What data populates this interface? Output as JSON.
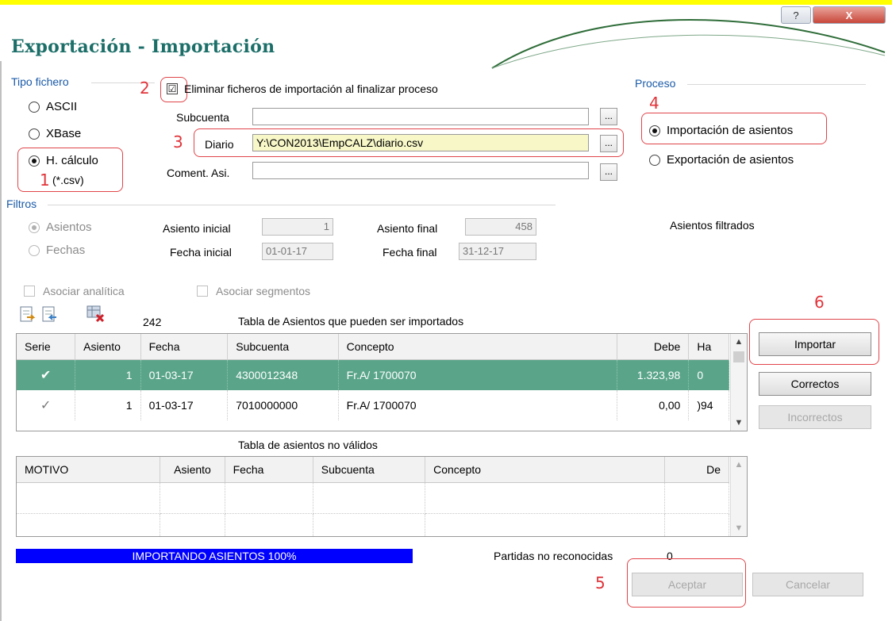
{
  "window": {
    "title": "Exportación - Importación",
    "help_label": "?",
    "close_label": "X"
  },
  "tipo_fichero": {
    "label": "Tipo fichero",
    "options": [
      {
        "label": "ASCII",
        "selected": false
      },
      {
        "label": "XBase",
        "selected": false
      },
      {
        "label": "H. cálculo",
        "sub": "(*.csv)",
        "selected": true
      }
    ]
  },
  "eliminar": {
    "label": "Eliminar ficheros de importación al finalizar proceso",
    "checked": true,
    "mark": "☑"
  },
  "files": {
    "subcuenta": {
      "label": "Subcuenta",
      "value": ""
    },
    "diario": {
      "label": "Diario",
      "value": "Y:\\CON2013\\EmpCALZ\\diario.csv"
    },
    "coment": {
      "label": "Coment. Asi.",
      "value": ""
    },
    "browse_label": "..."
  },
  "proceso": {
    "label": "Proceso",
    "options": [
      {
        "label": "Importación de asientos",
        "selected": true
      },
      {
        "label": "Exportación de asientos",
        "selected": false
      }
    ]
  },
  "filtros": {
    "label": "Filtros",
    "asientos": "Asientos",
    "fechas": "Fechas",
    "asiento_inicial_label": "Asiento inicial",
    "asiento_inicial": "1",
    "asiento_final_label": "Asiento final",
    "asiento_final": "458",
    "fecha_inicial_label": "Fecha inicial",
    "fecha_inicial": "01-01-17",
    "fecha_final_label": "Fecha final",
    "fecha_final": "31-12-17",
    "filtrados_label": "Asientos filtrados"
  },
  "asociar": {
    "analitica": "Asociar analítica",
    "segmentos": "Asociar segmentos"
  },
  "toolbar": {
    "count": "242",
    "table_title": "Tabla de Asientos que pueden ser importados"
  },
  "import_table": {
    "columns": [
      "Serie",
      "Asiento",
      "Fecha",
      "Subcuenta",
      "Concepto",
      "Debe",
      "Ha"
    ],
    "rows": [
      {
        "serie": "✔",
        "asiento": "1",
        "fecha": "01-03-17",
        "subcuenta": "4300012348",
        "concepto": "Fr.A/ 1700070",
        "debe": "1.323,98",
        "haber": "0"
      },
      {
        "serie": "✓",
        "asiento": "1",
        "fecha": "01-03-17",
        "subcuenta": "7010000000",
        "concepto": "Fr.A/ 1700070",
        "debe": "0,00",
        "haber": ")94"
      }
    ]
  },
  "invalid_table": {
    "title": "Tabla de asientos no válidos",
    "columns": [
      "MOTIVO",
      "Asiento",
      "Fecha",
      "Subcuenta",
      "Concepto",
      "De"
    ]
  },
  "buttons": {
    "importar": "Importar",
    "correctos": "Correctos",
    "incorrectos": "Incorrectos",
    "aceptar": "Aceptar",
    "cancelar": "Cancelar"
  },
  "progress": {
    "text": "IMPORTANDO ASIENTOS 100%",
    "percent": 100
  },
  "partidas": {
    "label": "Partidas no reconocidas",
    "value": "0"
  },
  "annotations": [
    "1",
    "2",
    "3",
    "4",
    "5",
    "6"
  ],
  "colors": {
    "title": "#1c6e68",
    "group_label": "#1a5aa8",
    "annotation": "#e0343a",
    "selected_row": "#5aa58a",
    "progress": "#0000ff",
    "diario_field": "#f7f7c8"
  }
}
